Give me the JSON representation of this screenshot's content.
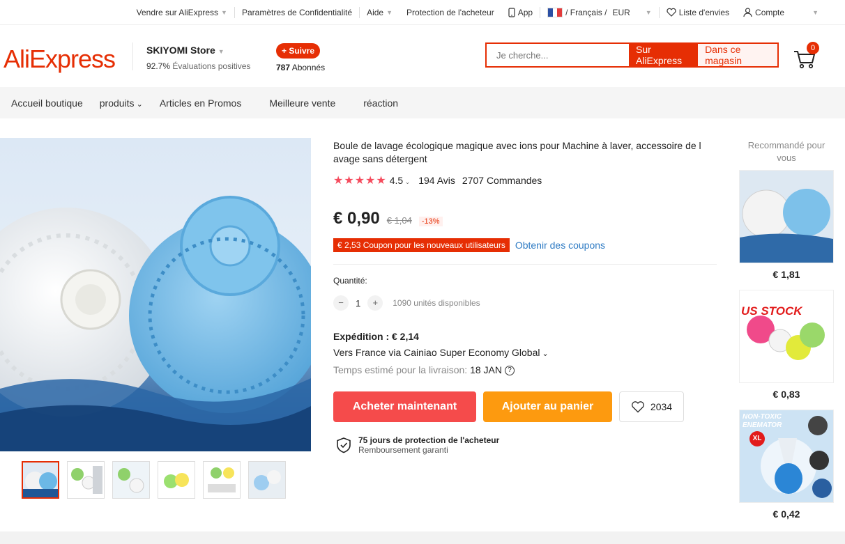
{
  "topbar": {
    "sell": "Vendre sur AliExpress",
    "privacy": "Paramètres de Confidentialité",
    "help": "Aide",
    "protection": "Protection de l'acheteur",
    "app": "App",
    "language": "/ Français /",
    "currency": "EUR",
    "wishlist": "Liste d'envies",
    "account": "Compte"
  },
  "header": {
    "logo": "AliExpress",
    "store_name": "SKIYOMI Store",
    "rating_value": "92.7%",
    "rating_label": "Évaluations positives",
    "follow_label": "+ Suivre",
    "followers_count": "787",
    "followers_label": "Abonnés",
    "search_placeholder": "Je cherche...",
    "search_aliexpress": "Sur AliExpress",
    "search_store": "Dans ce magasin",
    "cart_count": "0"
  },
  "nav": {
    "items": [
      "Accueil boutique",
      "produits",
      "Articles en Promos",
      "Meilleure vente",
      "réaction"
    ]
  },
  "product": {
    "title": "Boule de lavage écologique magique avec ions pour Machine à laver, accessoire de l avage sans détergent",
    "stars": "★★★★★",
    "rating": "4.5",
    "reviews": "194 Avis",
    "orders": "2707 Commandes",
    "price": "€ 0,90",
    "old_price": "€ 1,04",
    "discount": "-13%",
    "coupon": "€ 2,53 Coupon pour les nouveaux utilisateurs",
    "get_coupons": "Obtenir des coupons",
    "quantity_label": "Quantité:",
    "quantity": "1",
    "available": "1090 unités disponibles",
    "shipping_cost": "Expédition : € 2,14",
    "shipping_route": "Vers France via Cainiao Super Economy Global",
    "delivery_label": "Temps estimé pour la livraison:",
    "delivery_date": "18 JAN",
    "buy_now": "Acheter maintenant",
    "add_cart": "Ajouter au panier",
    "wish_count": "2034",
    "protection_title": "75 jours de protection de l'acheteur",
    "protection_sub": "Remboursement garanti"
  },
  "recommended": {
    "title": "Recommandé pour vous",
    "items": [
      {
        "price": "€ 1,81"
      },
      {
        "price": "€ 0,83",
        "overlay": "US STOCK"
      },
      {
        "price": "€ 0,42",
        "overlay": "NON-TOXIC ENEMATOR",
        "badge": "XL"
      }
    ]
  },
  "colors": {
    "brand": "#e62e04",
    "buy": "#f54b4b",
    "cart": "#fd9a0f",
    "link": "#2e7bc4"
  }
}
